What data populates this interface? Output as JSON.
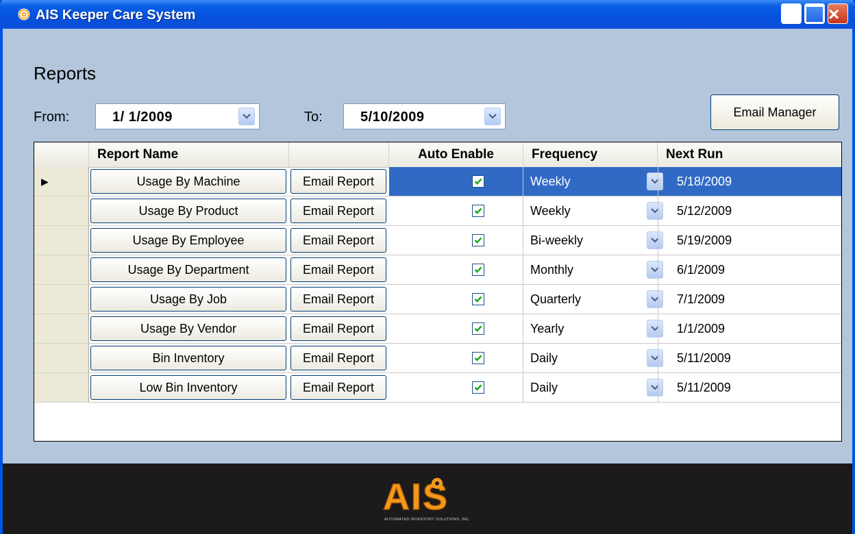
{
  "window": {
    "title": "AIS Keeper Care System"
  },
  "page": {
    "heading": "Reports",
    "from_label": "From:",
    "from_date": "1/ 1/2009",
    "to_label": "To:",
    "to_date": "5/10/2009",
    "email_manager": "Email Manager"
  },
  "grid": {
    "columns": [
      "Report Name",
      "",
      "Auto Enable",
      "Frequency",
      "Next Run"
    ],
    "email_label": "Email Report",
    "rows": [
      {
        "name": "Usage By Machine",
        "auto": true,
        "frequency": "Weekly",
        "next_run": "5/18/2009",
        "selected": true
      },
      {
        "name": "Usage By Product",
        "auto": true,
        "frequency": "Weekly",
        "next_run": "5/12/2009"
      },
      {
        "name": "Usage By Employee",
        "auto": true,
        "frequency": "Bi-weekly",
        "next_run": "5/19/2009"
      },
      {
        "name": "Usage By Department",
        "auto": true,
        "frequency": "Monthly",
        "next_run": "6/1/2009"
      },
      {
        "name": "Usage By Job",
        "auto": true,
        "frequency": "Quarterly",
        "next_run": "7/1/2009"
      },
      {
        "name": "Usage By Vendor",
        "auto": true,
        "frequency": "Yearly",
        "next_run": "1/1/2009"
      },
      {
        "name": "Bin Inventory",
        "auto": true,
        "frequency": "Daily",
        "next_run": "5/11/2009"
      },
      {
        "name": "Low Bin Inventory",
        "auto": true,
        "frequency": "Daily",
        "next_run": "5/11/2009"
      }
    ]
  },
  "footer": {
    "logo_text": "AIS",
    "logo_subtext": "AUTOMATED INVENTORY SOLUTIONS, INC."
  },
  "colors": {
    "titlebar": "#0550dd",
    "selection": "#316ac5",
    "window_bg": "#b3c6dc",
    "footer": "#1c1a1a",
    "logo_orange": "#f39a1e"
  },
  "icons": [
    "app-icon",
    "minimize-icon",
    "maximize-icon",
    "close-icon",
    "dropdown-arrow-icon",
    "row-pointer-icon",
    "checkbox-check-icon"
  ]
}
